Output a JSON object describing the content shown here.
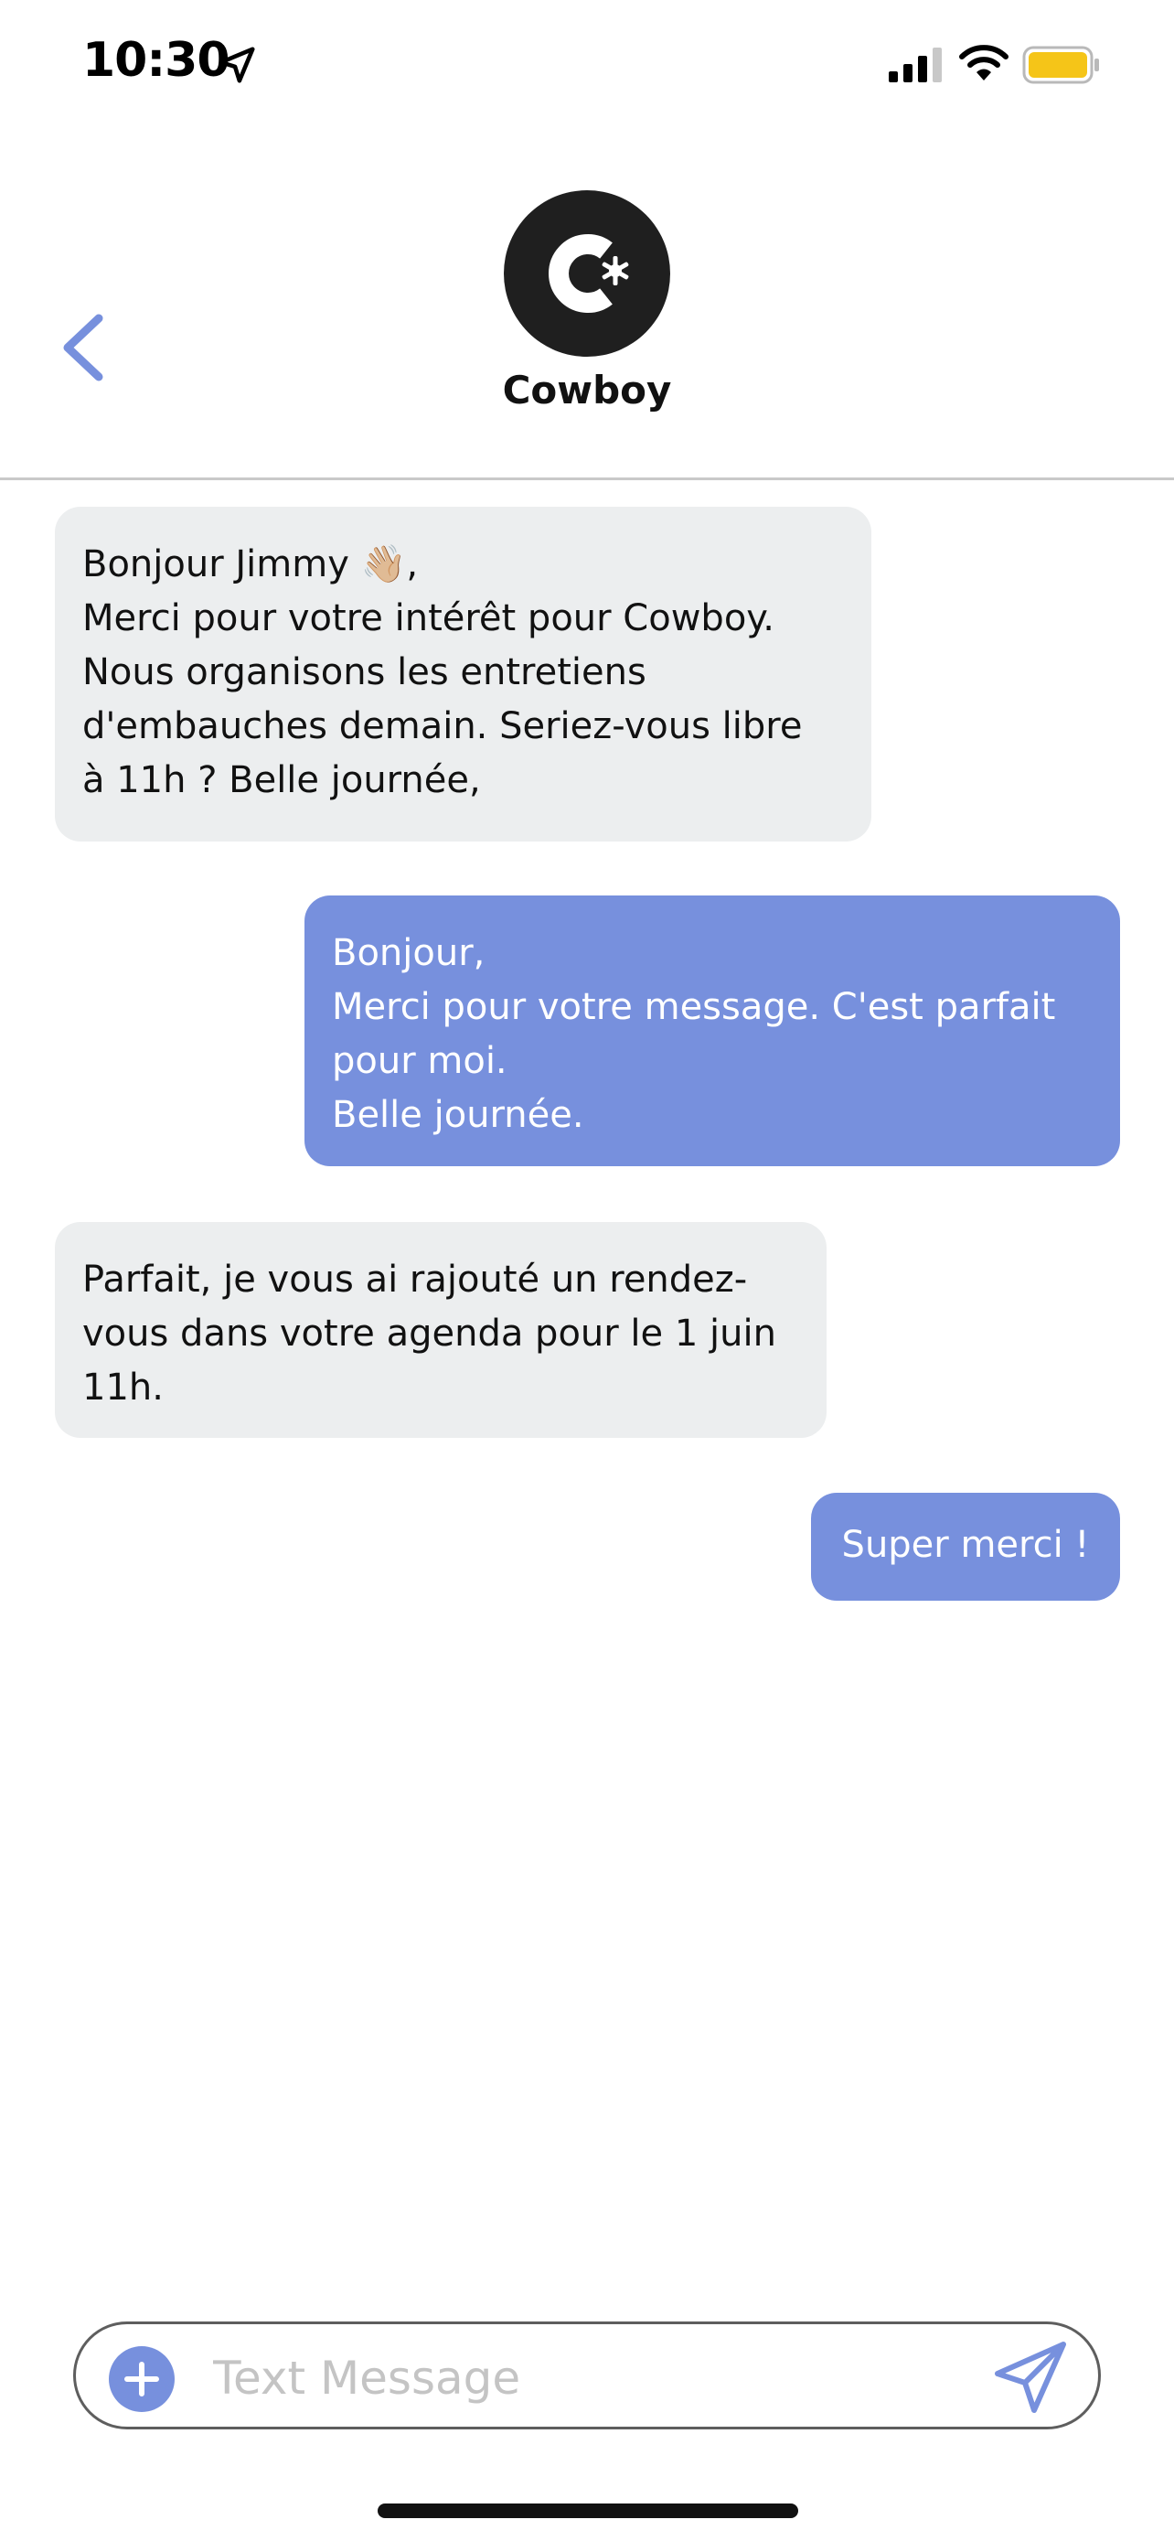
{
  "status_bar": {
    "time": "10:30",
    "icons": [
      "location-arrow-icon",
      "cellular-signal-icon",
      "wifi-icon",
      "battery-icon"
    ],
    "battery_color": "#f5c518"
  },
  "header": {
    "back_icon": "chevron-left-icon",
    "contact_name": "Cowboy",
    "avatar_icon": "cowboy-logo-icon"
  },
  "messages": [
    {
      "direction": "incoming",
      "text": "Bonjour Jimmy 👋🏼,\nMerci pour votre intérêt pour Cowboy.\nNous organisons les entretiens\nd'embauches demain. Seriez-vous libre\nà 11h ? Belle journée,"
    },
    {
      "direction": "outgoing",
      "text": "Bonjour,\nMerci pour votre message. C'est parfait\npour moi.\nBelle journée."
    },
    {
      "direction": "incoming",
      "text": "Parfait, je vous ai rajouté un rendez-\nvous dans votre agenda pour le 1 juin\n11h."
    },
    {
      "direction": "outgoing",
      "text": "Super merci !"
    }
  ],
  "composer": {
    "placeholder": "Text Message",
    "value": "",
    "add_icon": "plus-icon",
    "send_icon": "send-icon"
  },
  "colors": {
    "accent": "#7790dd",
    "incoming_bubble": "#eceeef",
    "divider": "#c9c9c9",
    "avatar_bg": "#1f1f1f"
  }
}
